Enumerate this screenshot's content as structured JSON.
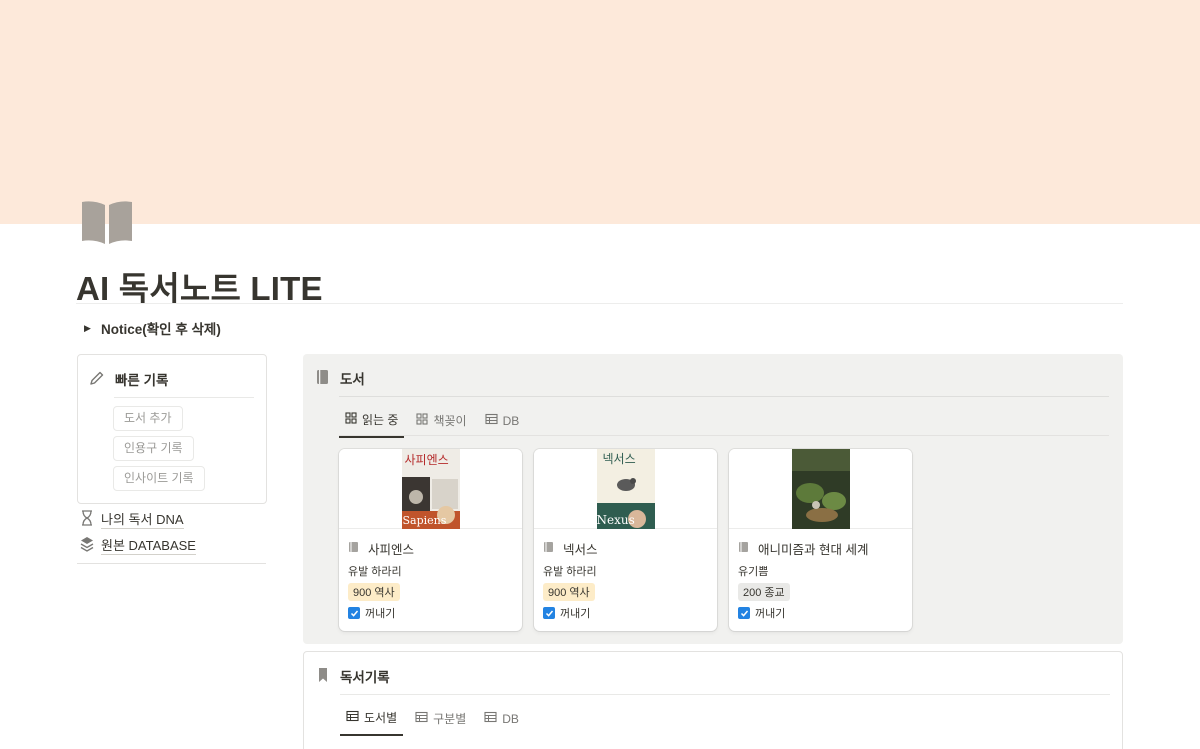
{
  "page": {
    "title": "AI 독서노트 LITE",
    "icon": "open-book-icon",
    "cover_color": "#fde9da",
    "notice_toggle": "Notice(확인 후 삭제)"
  },
  "quick_record": {
    "title": "빠른 기록",
    "icon": "pencil-icon",
    "buttons": [
      "도서 추가",
      "인용구 기록",
      "인사이트 기록"
    ]
  },
  "side_links": [
    {
      "label": "나의 독서 DNA",
      "icon": "hourglass-icon"
    },
    {
      "label": "원본 DATABASE",
      "icon": "layers-icon"
    }
  ],
  "books": {
    "title": "도서",
    "icon": "book-icon",
    "tabs": [
      {
        "label": "읽는 중",
        "icon": "gallery-icon",
        "active": true
      },
      {
        "label": "책꽂이",
        "icon": "gallery-icon",
        "active": false
      },
      {
        "label": "DB",
        "icon": "table-icon",
        "active": false
      }
    ],
    "cards": [
      {
        "title": "사피엔스",
        "author": "유발 하라리",
        "tag": "900 역사",
        "tag_color": "#fdecc8",
        "checkbox_label": "꺼내기",
        "checked": true,
        "cover_text": "사피엔스",
        "cover_sub": "Sapiens"
      },
      {
        "title": "넥서스",
        "author": "유발 하라리",
        "tag": "900 역사",
        "tag_color": "#fdecc8",
        "checkbox_label": "꺼내기",
        "checked": true,
        "cover_text": "넥서스",
        "cover_sub": "Nexus"
      },
      {
        "title": "애니미즘과 현대 세계",
        "author": "유기쁨",
        "tag": "200 종교",
        "tag_color": "#e9e9e7",
        "checkbox_label": "꺼내기",
        "checked": true,
        "cover_text": "",
        "cover_sub": ""
      }
    ]
  },
  "reading_log": {
    "title": "독서기록",
    "icon": "bookmark-icon",
    "tabs": [
      {
        "label": "도서별",
        "icon": "table-icon",
        "active": true
      },
      {
        "label": "구분별",
        "icon": "table-icon",
        "active": false
      },
      {
        "label": "DB",
        "icon": "table-icon",
        "active": false
      }
    ]
  }
}
